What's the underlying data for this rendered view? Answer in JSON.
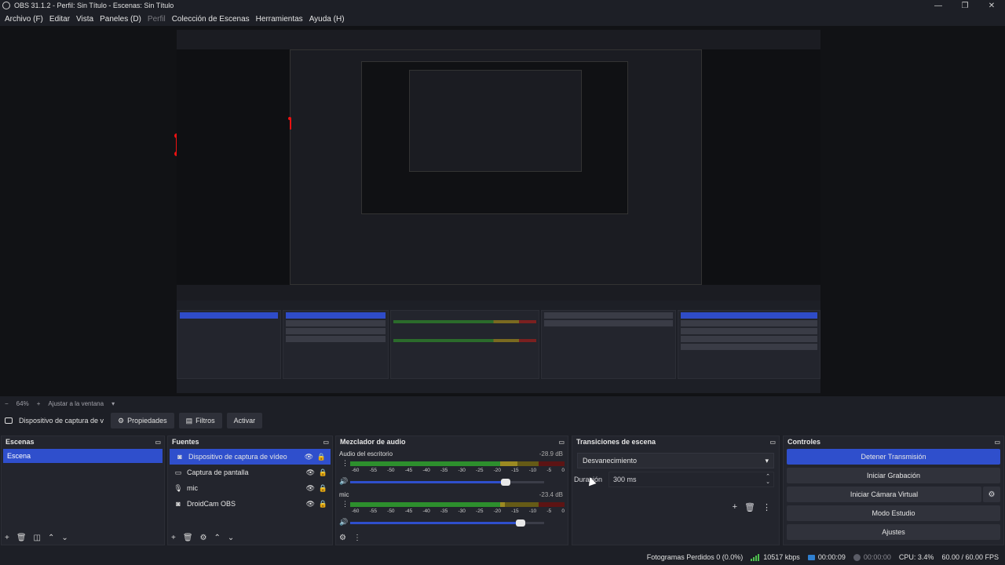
{
  "window": {
    "title": "OBS 31.1.2 - Perfil: Sin Título - Escenas: Sin Título",
    "min": "—",
    "max": "❐",
    "close": "✕"
  },
  "menu": [
    "Archivo (F)",
    "Editar",
    "Vista",
    "Paneles (D)",
    "Perfil",
    "Colección de Escenas",
    "Herramientas",
    "Ayuda (H)"
  ],
  "zoom": {
    "minus": "−",
    "level": "64%",
    "plus": "+",
    "fit": "Ajustar a la ventana",
    "arrow": "▾"
  },
  "source_toolbar": {
    "source_name": "Dispositivo de captura de v",
    "properties": "Propiedades",
    "filters": "Filtros",
    "activate": "Activar"
  },
  "scenes": {
    "title": "Escenas",
    "items": [
      "Escena"
    ]
  },
  "sources": {
    "title": "Fuentes",
    "items": [
      {
        "icon": "camera-icon",
        "glyph": "◙",
        "label": "Dispositivo de captura de vídeo"
      },
      {
        "icon": "monitor-icon",
        "glyph": "▭",
        "label": "Captura de pantalla"
      },
      {
        "icon": "microphone-icon",
        "glyph": "🎙",
        "label": "mic"
      },
      {
        "icon": "camera-icon",
        "glyph": "◙",
        "label": "DroidCam OBS"
      }
    ]
  },
  "mixer": {
    "title": "Mezclador de audio",
    "ticks": [
      "-60",
      "-55",
      "-50",
      "-45",
      "-40",
      "-35",
      "-30",
      "-25",
      "-20",
      "-15",
      "-10",
      "-5",
      "0"
    ],
    "channels": [
      {
        "name": "Audio del escritorio",
        "db": "-28.9 dB",
        "level": 0.78,
        "volume": 0.8
      },
      {
        "name": "mic",
        "db": "-23.4 dB",
        "level": 0.72,
        "volume": 0.88
      }
    ]
  },
  "transitions": {
    "title": "Transiciones de escena",
    "selected": "Desvanecimiento",
    "duration_label": "Duración",
    "duration_value": "300 ms"
  },
  "controls": {
    "title": "Controles",
    "stop_stream": "Detener Transmisión",
    "start_recording": "Iniciar Grabación",
    "start_virtual_cam": "Iniciar Cámara Virtual",
    "studio_mode": "Modo Estudio",
    "settings": "Ajustes"
  },
  "status": {
    "dropped_frames": "Fotogramas Perdidos 0 (0.0%)",
    "bitrate": "10517 kbps",
    "stream_time": "00:00:09",
    "record_time": "00:00:00",
    "cpu": "CPU: 3.4%",
    "fps": "60.00 / 60.00 FPS"
  },
  "colors": {
    "accent": "#2f4fcc",
    "panel": "#23252d",
    "background": "#1d1f26"
  }
}
